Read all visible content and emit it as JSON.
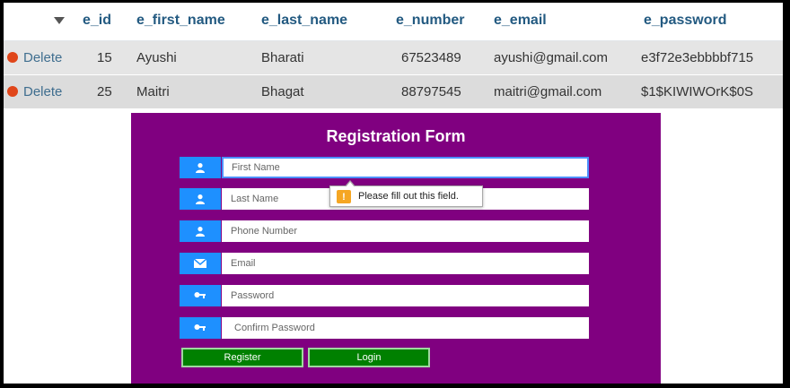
{
  "table": {
    "columns": [
      "e_id",
      "e_first_name",
      "e_last_name",
      "e_number",
      "e_email",
      "e_password"
    ],
    "delete_label": "Delete",
    "rows": [
      {
        "e_id": "15",
        "e_first_name": "Ayushi",
        "e_last_name": "Bharati",
        "e_number": "67523489",
        "e_email": "ayushi@gmail.com",
        "e_password": "e3f72e3ebbbbf715"
      },
      {
        "e_id": "25",
        "e_first_name": "Maitri",
        "e_last_name": "Bhagat",
        "e_number": "88797545",
        "e_email": "maitri@gmail.com",
        "e_password": "$1$KIWIWOrK$0S"
      }
    ]
  },
  "form": {
    "title": "Registration Form",
    "fields": [
      {
        "icon": "user-icon",
        "placeholder": "First Name",
        "value": ""
      },
      {
        "icon": "user-icon",
        "placeholder": "Last Name",
        "value": ""
      },
      {
        "icon": "user-icon",
        "placeholder": "Phone Number",
        "value": ""
      },
      {
        "icon": "envelope-icon",
        "placeholder": "Email",
        "value": ""
      },
      {
        "icon": "key-icon",
        "placeholder": "Password",
        "value": ""
      },
      {
        "icon": "key-icon",
        "placeholder": "Confirm Password",
        "value": ""
      }
    ],
    "register_label": "Register",
    "login_label": "Login",
    "validation_tooltip": "Please fill out this field.",
    "warning_glyph": "!"
  },
  "colors": {
    "panel": "#800080",
    "icon_bg": "#1e90ff",
    "button": "#008000",
    "header_text": "#235a81"
  }
}
